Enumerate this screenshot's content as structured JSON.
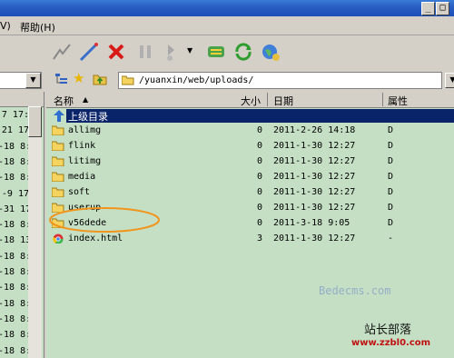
{
  "titlebar": {
    "min_glyph": "_",
    "max_glyph": "□"
  },
  "menubar": {
    "items": [
      {
        "label": "V)"
      },
      {
        "label": "帮助(H)"
      }
    ]
  },
  "toolbar": {
    "icons": [
      "connect-icon",
      "disconnect-icon",
      "stop-icon",
      "pause-icon",
      "transfer-icon",
      "compare-icon",
      "refresh-icon",
      "site-icon"
    ]
  },
  "pathbar": {
    "path": "/yuanxin/web/uploads/"
  },
  "leftpane": {
    "cells": [
      "7 17:",
      "21 17",
      "-18 8:",
      "-18 8:",
      "-18 8:",
      "-9 17",
      "-31 17",
      "-18 8:",
      "-18 13",
      "-18 8:",
      "-18 8:4",
      "-18 8:",
      "-18 8:",
      "-18 8:",
      "-18 8:",
      "-18 8:"
    ]
  },
  "filelist": {
    "columns": {
      "name": "名称",
      "size": "大小",
      "date": "日期",
      "attr": "属性"
    },
    "parent": {
      "name": "上级目录"
    },
    "rows": [
      {
        "name": "allimg",
        "size": "0",
        "date": "2011-2-26 14:18",
        "attr": "D",
        "type": "folder"
      },
      {
        "name": "flink",
        "size": "0",
        "date": "2011-1-30 12:27",
        "attr": "D",
        "type": "folder"
      },
      {
        "name": "litimg",
        "size": "0",
        "date": "2011-1-30 12:27",
        "attr": "D",
        "type": "folder"
      },
      {
        "name": "media",
        "size": "0",
        "date": "2011-1-30 12:27",
        "attr": "D",
        "type": "folder"
      },
      {
        "name": "soft",
        "size": "0",
        "date": "2011-1-30 12:27",
        "attr": "D",
        "type": "folder"
      },
      {
        "name": "userup",
        "size": "0",
        "date": "2011-1-30 12:27",
        "attr": "D",
        "type": "folder"
      },
      {
        "name": "v56dede",
        "size": "0",
        "date": "2011-3-18 9:05",
        "attr": "D",
        "type": "folder"
      },
      {
        "name": "index.html",
        "size": "3",
        "date": "2011-1-30 12:27",
        "attr": "-",
        "type": "file"
      }
    ]
  },
  "watermark": {
    "title": "站长部落",
    "url": "www.zzbl0.com",
    "faint": "Bedecms.com"
  },
  "colors": {
    "pane_bg": "#c5dfc5",
    "selection": "#0a246a",
    "annotation": "#f0941c"
  }
}
